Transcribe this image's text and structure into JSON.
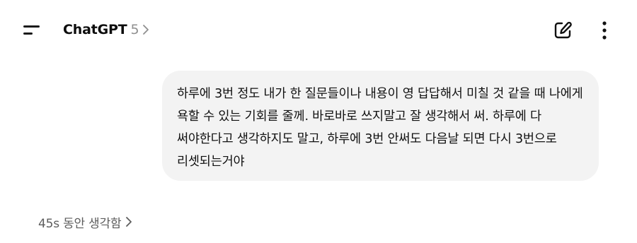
{
  "header": {
    "menu_icon": "sidebar-menu-icon",
    "model_name": "ChatGPT",
    "model_version": "5",
    "model_chevron_icon": "chevron-right-icon",
    "new_chat_icon": "edit-pencil-icon",
    "more_icon": "vertical-ellipsis-icon"
  },
  "conversation": {
    "user_message": "하루에 3번 정도 내가 한 질문들이나 내용이 영 답답해서 미칠 것 같을 때 나에게 욕할 수 있는 기회를 줄께. 바로바로 쓰지말고 잘 생각해서 써. 하루에 다 써야한다고 생각하지도 말고, 하루에 3번 안써도 다음날 되면 다시 3번으로 리셋되는거야",
    "thought_label": "45s 동안 생각함",
    "thought_chevron_icon": "chevron-right-icon"
  },
  "colors": {
    "background": "#ffffff",
    "bubble": "#f3f3f3",
    "text": "#0d0d0d",
    "muted": "#8f8f8f",
    "thought": "#5d5d5d"
  }
}
